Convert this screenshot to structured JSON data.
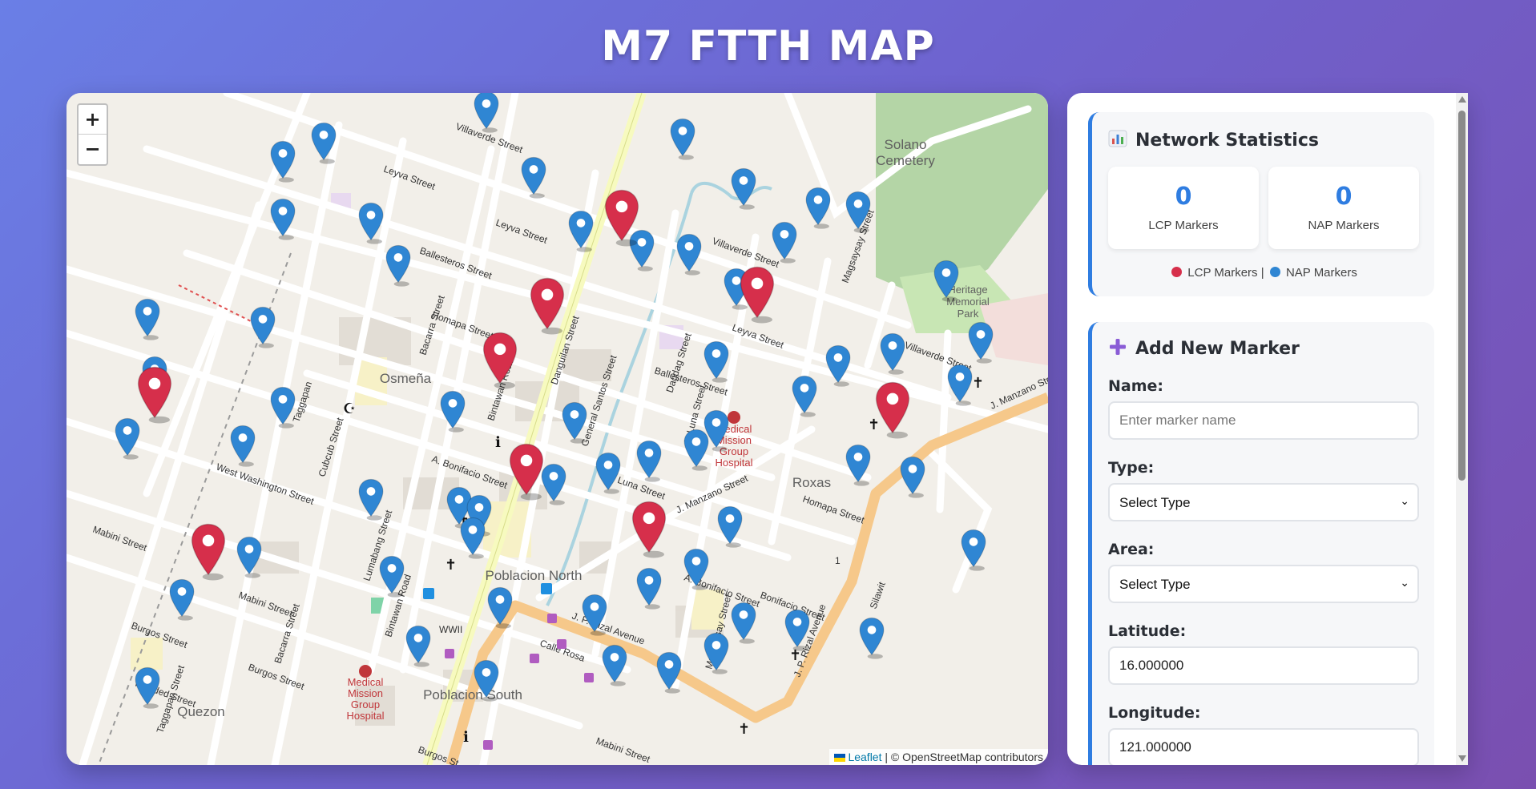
{
  "header": {
    "title": "M7 FTTH MAP"
  },
  "map": {
    "zoom_in_label": "+",
    "zoom_out_label": "−",
    "attribution": {
      "leaflet": "Leaflet",
      "rest": " | © OpenStreetMap contributors"
    },
    "place_labels": [
      {
        "text": "Solano"
      },
      {
        "text": "Cemetery"
      },
      {
        "text": "Heritage"
      },
      {
        "text": "Memorial"
      },
      {
        "text": "Park"
      },
      {
        "text": "Osmeña"
      },
      {
        "text": "Roxas"
      },
      {
        "text": "Poblacion North"
      },
      {
        "text": "Poblacion South"
      },
      {
        "text": "Quezon"
      },
      {
        "text": "Medical"
      },
      {
        "text": "Mission"
      },
      {
        "text": "Group"
      },
      {
        "text": "Hospital"
      }
    ],
    "street_labels": [
      "Villaverde Street",
      "Leyva Street",
      "Leyva Street",
      "Villaverde Street",
      "Magsaysay Street",
      "Ballesteros Street",
      "Homapa Street",
      "Bacarra Street",
      "Bintawan Road",
      "Danguilan Street",
      "General Santos Street",
      "Dagdag Street",
      "A. Luna Street",
      "Leyva Street",
      "Ballesteros Street",
      "Villaverde Street",
      "Taggapan",
      "Cubcub Street",
      "West Washington Street",
      "Mabini Street",
      "A. Bonifacio Street",
      "J. Luna Street",
      "J. Manzano Street",
      "Homapa Street",
      "Lumabang Street",
      "Mabini Street",
      "Burgos Street",
      "Bacarra Street",
      "Bintawan Road",
      "Burgos Street",
      "Piarided Street",
      "Taggapan Street",
      "J. P. Rizal Avenue",
      "Calle Rosa",
      "A. Bonifacio Street",
      "Bonifacio Street",
      "J. P. Rizal Avenue",
      "Magsaysay Street",
      "Silawit",
      "J. Manzano Street",
      "Burgos St",
      "Mabini Street",
      "WWII",
      "1"
    ]
  },
  "markers": {
    "lcp_color": "#d62f4b",
    "nap_color": "#2f86d3",
    "lcp": [
      {
        "lat": 16.0012,
        "lng": 121.0032
      },
      {
        "lat": 15.9989,
        "lng": 121.0021
      },
      {
        "lat": 15.9975,
        "lng": 121.0014
      },
      {
        "lat": 15.9946,
        "lng": 121.0018
      },
      {
        "lat": 15.9966,
        "lng": 120.9963
      },
      {
        "lat": 15.9931,
        "lng": 121.0036
      },
      {
        "lat": 15.9925,
        "lng": 120.9971
      },
      {
        "lat": 15.9962,
        "lng": 121.0072
      },
      {
        "lat": 15.9992,
        "lng": 121.0052
      }
    ],
    "nap": [
      {
        "lat": 16.0033,
        "lng": 120.9988
      },
      {
        "lat": 16.0041,
        "lng": 121.0012
      },
      {
        "lat": 16.0028,
        "lng": 120.9982
      },
      {
        "lat": 16.0034,
        "lng": 121.0041
      },
      {
        "lat": 16.0024,
        "lng": 121.0019
      },
      {
        "lat": 16.0021,
        "lng": 121.005
      },
      {
        "lat": 16.0016,
        "lng": 121.0061
      },
      {
        "lat": 16.0015,
        "lng": 121.0067
      },
      {
        "lat": 16.0013,
        "lng": 120.9982
      },
      {
        "lat": 16.0012,
        "lng": 120.9995
      },
      {
        "lat": 16.001,
        "lng": 121.0026
      },
      {
        "lat": 16.0007,
        "lng": 121.0056
      },
      {
        "lat": 16.0005,
        "lng": 121.0035
      },
      {
        "lat": 16.0004,
        "lng": 121.0042
      },
      {
        "lat": 16.0001,
        "lng": 120.9999
      },
      {
        "lat": 15.9997,
        "lng": 121.008
      },
      {
        "lat": 15.9995,
        "lng": 121.0049
      },
      {
        "lat": 15.9987,
        "lng": 120.9962
      },
      {
        "lat": 15.9985,
        "lng": 120.9979
      },
      {
        "lat": 15.9981,
        "lng": 121.0085
      },
      {
        "lat": 15.9978,
        "lng": 121.0072
      },
      {
        "lat": 15.9976,
        "lng": 121.0046
      },
      {
        "lat": 15.9975,
        "lng": 121.0064
      },
      {
        "lat": 15.9972,
        "lng": 120.9963
      },
      {
        "lat": 15.997,
        "lng": 121.0082
      },
      {
        "lat": 15.9967,
        "lng": 121.0059
      },
      {
        "lat": 15.9964,
        "lng": 120.9982
      },
      {
        "lat": 15.9963,
        "lng": 121.0007
      },
      {
        "lat": 15.996,
        "lng": 121.0025
      },
      {
        "lat": 15.9958,
        "lng": 121.0046
      },
      {
        "lat": 15.9956,
        "lng": 120.9959
      },
      {
        "lat": 15.9954,
        "lng": 120.9976
      },
      {
        "lat": 15.9953,
        "lng": 121.0043
      },
      {
        "lat": 15.995,
        "lng": 121.0036
      },
      {
        "lat": 15.9949,
        "lng": 121.0067
      },
      {
        "lat": 15.9947,
        "lng": 121.003
      },
      {
        "lat": 15.9946,
        "lng": 121.0075
      },
      {
        "lat": 15.9944,
        "lng": 121.0022
      },
      {
        "lat": 15.994,
        "lng": 120.9995
      },
      {
        "lat": 15.9938,
        "lng": 121.0008
      },
      {
        "lat": 15.9936,
        "lng": 121.0011
      },
      {
        "lat": 15.9933,
        "lng": 121.0048
      },
      {
        "lat": 15.993,
        "lng": 121.001
      },
      {
        "lat": 15.9927,
        "lng": 121.0084
      },
      {
        "lat": 15.9925,
        "lng": 120.9977
      },
      {
        "lat": 15.9922,
        "lng": 121.0043
      },
      {
        "lat": 15.992,
        "lng": 120.9998
      },
      {
        "lat": 15.9917,
        "lng": 121.0036
      },
      {
        "lat": 15.9914,
        "lng": 120.9967
      },
      {
        "lat": 15.9912,
        "lng": 121.0014
      },
      {
        "lat": 15.991,
        "lng": 121.0028
      },
      {
        "lat": 15.9908,
        "lng": 121.005
      },
      {
        "lat": 15.9906,
        "lng": 121.0058
      },
      {
        "lat": 15.9904,
        "lng": 121.0069
      },
      {
        "lat": 15.9902,
        "lng": 121.0002
      },
      {
        "lat": 15.99,
        "lng": 121.0046
      },
      {
        "lat": 15.9897,
        "lng": 121.0031
      },
      {
        "lat": 15.9895,
        "lng": 121.0039
      },
      {
        "lat": 15.9893,
        "lng": 121.0012
      },
      {
        "lat": 15.9891,
        "lng": 120.9962
      }
    ]
  },
  "sidebar": {
    "stats": {
      "title": "Network Statistics",
      "lcp_count": "0",
      "lcp_label": "LCP Markers",
      "nap_count": "0",
      "nap_label": "NAP Markers",
      "legend_lcp": "LCP Markers |",
      "legend_nap": "NAP Markers"
    },
    "add": {
      "title": "Add New Marker",
      "name_label": "Name:",
      "name_placeholder": "Enter marker name",
      "type_label": "Type:",
      "type_selected": "Select Type",
      "area_label": "Area:",
      "area_selected": "Select Type",
      "lat_label": "Latitude:",
      "lat_value": "16.000000",
      "lng_label": "Longitude:",
      "lng_value": "121.000000"
    }
  }
}
